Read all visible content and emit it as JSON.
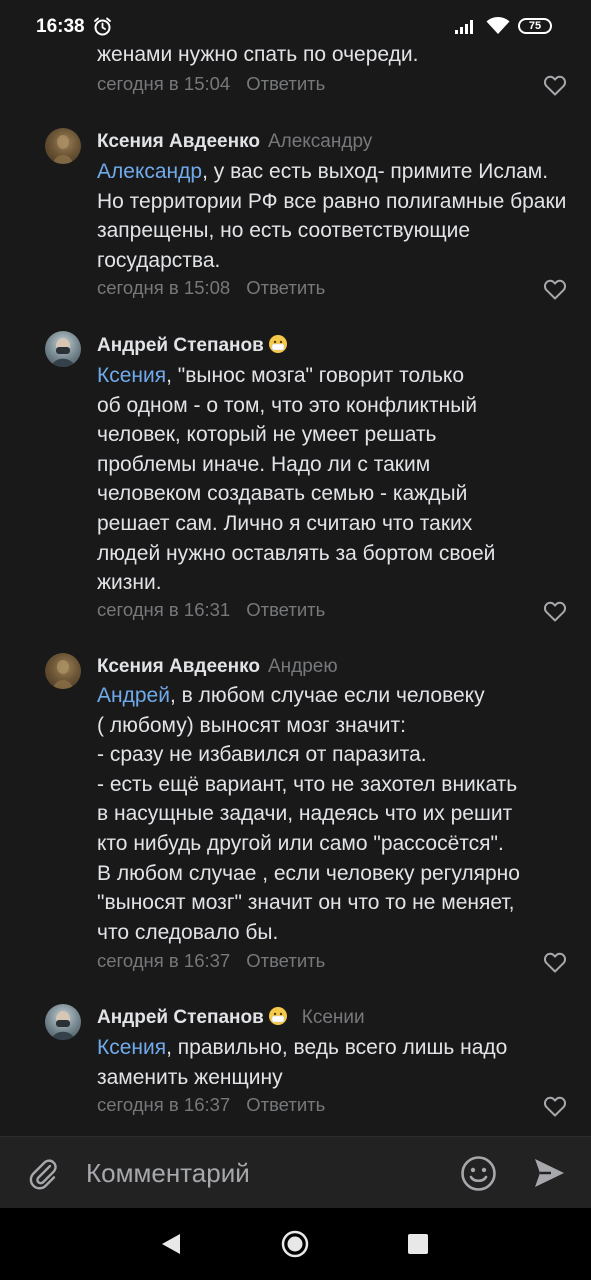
{
  "status_bar": {
    "time": "16:38",
    "battery": "75"
  },
  "composer": {
    "placeholder": "Комментарий"
  },
  "comments": [
    {
      "text_tail": "женами нужно спать по очереди.",
      "time": "сегодня в 15:04",
      "reply_label": "Ответить"
    },
    {
      "author": "Ксения Авдеенко",
      "reply_to": "Александру",
      "mention": "Александр",
      "text": ", у вас есть выход- примите Ислам. Но территории РФ все равно полигамные браки запрещены, но есть соответствующие государства.",
      "time": "сегодня в 15:08",
      "reply_label": "Ответить"
    },
    {
      "author": "Андрей Степанов",
      "author_emoji": "mask-face-emoji",
      "mention": "Ксения",
      "text": ", \"вынос мозга\" говорит только\nоб одном - о том, что это конфликтный\nчеловек, который не умеет решать\nпроблемы иначе. Надо ли с таким\nчеловеком создавать семью - каждый\nрешает сам. Лично я считаю что таких\nлюдей нужно оставлять за бортом своей\nжизни.",
      "time": "сегодня в 16:31",
      "reply_label": "Ответить"
    },
    {
      "author": "Ксения Авдеенко",
      "reply_to": "Андрею",
      "mention": "Андрей",
      "text": ", в любом случае если человеку\n( любому) выносят мозг значит:\n- сразу не избавился от паразита.\n- есть ещё вариант, что не захотел вникать\nв насущные задачи, надеясь что их решит\nкто нибудь другой или само \"рассосётся\".\nВ любом случае , если человеку регулярно\n\"выносят мозг\" значит он что то не меняет,\nчто следовало бы.",
      "time": "сегодня в 16:37",
      "reply_label": "Ответить"
    },
    {
      "author": "Андрей Степанов",
      "author_emoji": "mask-face-emoji",
      "reply_to": "Ксении",
      "mention": "Ксения",
      "text": ", правильно, ведь всего лишь надо\nзаменить женщину",
      "time": "сегодня в 16:37",
      "reply_label": "Ответить"
    }
  ]
}
